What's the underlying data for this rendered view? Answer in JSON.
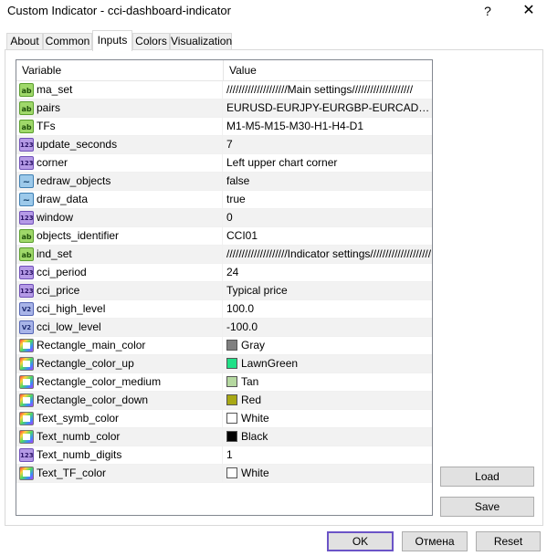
{
  "window": {
    "title": "Custom Indicator - cci-dashboard-indicator",
    "help_glyph": "?",
    "close_glyph": "✕"
  },
  "tabs": [
    {
      "label": "About",
      "active": false
    },
    {
      "label": "Common",
      "active": false
    },
    {
      "label": "Inputs",
      "active": true
    },
    {
      "label": "Colors",
      "active": false
    },
    {
      "label": "Visualization",
      "active": false
    }
  ],
  "grid": {
    "col_variable": "Variable",
    "col_value": "Value",
    "rows": [
      {
        "type": "ab",
        "name": "ma_set",
        "value": "////////////////////Main settings////////////////////"
      },
      {
        "type": "ab",
        "name": "pairs",
        "value": "EURUSD-EURJPY-EURGBP-EURCAD-EURAUD"
      },
      {
        "type": "ab",
        "name": "TFs",
        "value": "M1-M5-M15-M30-H1-H4-D1"
      },
      {
        "type": "num",
        "name": "update_seconds",
        "value": "7"
      },
      {
        "type": "num",
        "name": "corner",
        "value": "Left upper chart corner"
      },
      {
        "type": "bool",
        "name": "redraw_objects",
        "value": "false"
      },
      {
        "type": "bool",
        "name": "draw_data",
        "value": "true"
      },
      {
        "type": "num",
        "name": "window",
        "value": "0"
      },
      {
        "type": "ab",
        "name": "objects_identifier",
        "value": "CCI01"
      },
      {
        "type": "ab",
        "name": "ind_set",
        "value": "////////////////////Indicator settings////////////////////"
      },
      {
        "type": "num",
        "name": "cci_period",
        "value": "24"
      },
      {
        "type": "num",
        "name": "cci_price",
        "value": "Typical price"
      },
      {
        "type": "dbl",
        "name": "cci_high_level",
        "value": "100.0"
      },
      {
        "type": "dbl",
        "name": "cci_low_level",
        "value": "-100.0"
      },
      {
        "type": "color",
        "name": "Rectangle_main_color",
        "value": "Gray",
        "swatch": "#808080"
      },
      {
        "type": "color",
        "name": "Rectangle_color_up",
        "value": "LawnGreen",
        "swatch": "#21e087"
      },
      {
        "type": "color",
        "name": "Rectangle_color_medium",
        "value": "Tan",
        "swatch": "#b5d8a0"
      },
      {
        "type": "color",
        "name": "Rectangle_color_down",
        "value": "Red",
        "swatch": "#a8a814"
      },
      {
        "type": "color",
        "name": "Text_symb_color",
        "value": "White",
        "swatch": "#ffffff"
      },
      {
        "type": "color",
        "name": "Text_numb_color",
        "value": "Black",
        "swatch": "#000000"
      },
      {
        "type": "num",
        "name": "Text_numb_digits",
        "value": "1"
      },
      {
        "type": "color",
        "name": "Text_TF_color",
        "value": "White",
        "swatch": "#ffffff"
      }
    ]
  },
  "icon_text": {
    "ab": "ab",
    "num": "123",
    "bool": "~",
    "dbl": "V2",
    "color": ""
  },
  "buttons": {
    "load": "Load",
    "save": "Save",
    "ok": "OK",
    "cancel": "Отмена",
    "reset": "Reset"
  }
}
